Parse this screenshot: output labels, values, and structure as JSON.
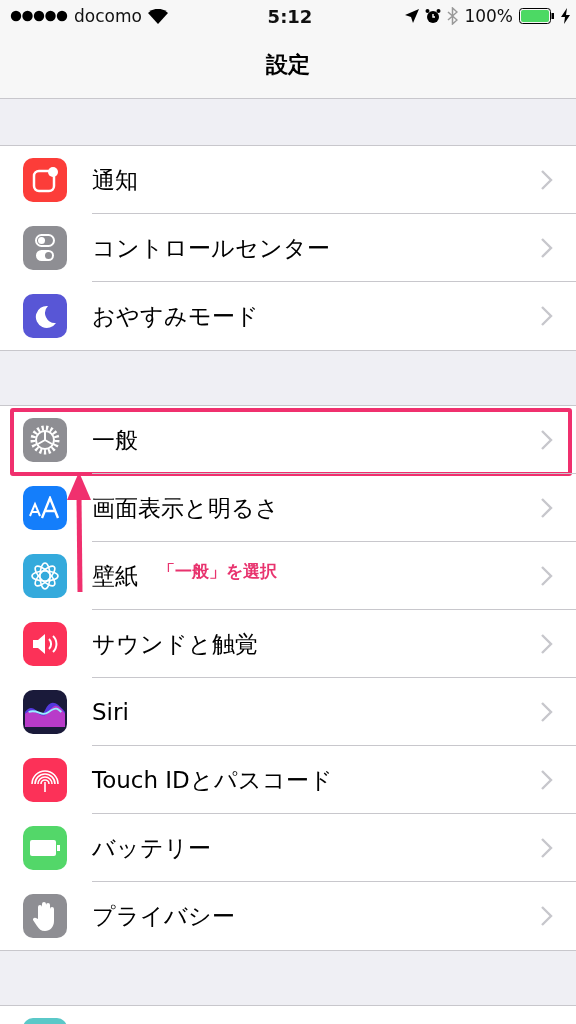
{
  "status_bar": {
    "carrier": "docomo",
    "time": "5:12",
    "battery_text": "100%",
    "battery": {
      "level": 1,
      "charging": true
    }
  },
  "nav": {
    "title": "設定"
  },
  "sections": [
    {
      "items": [
        {
          "kind": "notifications",
          "label": "通知"
        },
        {
          "kind": "control",
          "label": "コントロールセンター"
        },
        {
          "kind": "moon",
          "label": "おやすみモード"
        }
      ]
    },
    {
      "items": [
        {
          "kind": "gear",
          "label": "一般",
          "highlighted": true
        },
        {
          "kind": "display",
          "label": "画面表示と明るさ"
        },
        {
          "kind": "flower",
          "label": "壁紙"
        },
        {
          "kind": "sound",
          "label": "サウンドと触覚"
        },
        {
          "kind": "siri",
          "label": "Siri"
        },
        {
          "kind": "fingerprint",
          "label": "Touch IDとパスコード"
        },
        {
          "kind": "battery",
          "label": "バッテリー"
        },
        {
          "kind": "hand",
          "label": "プライバシー"
        }
      ]
    },
    {
      "items": [
        {
          "kind": "partial"
        }
      ]
    }
  ],
  "annotation": {
    "text": "「一般」を選択"
  }
}
